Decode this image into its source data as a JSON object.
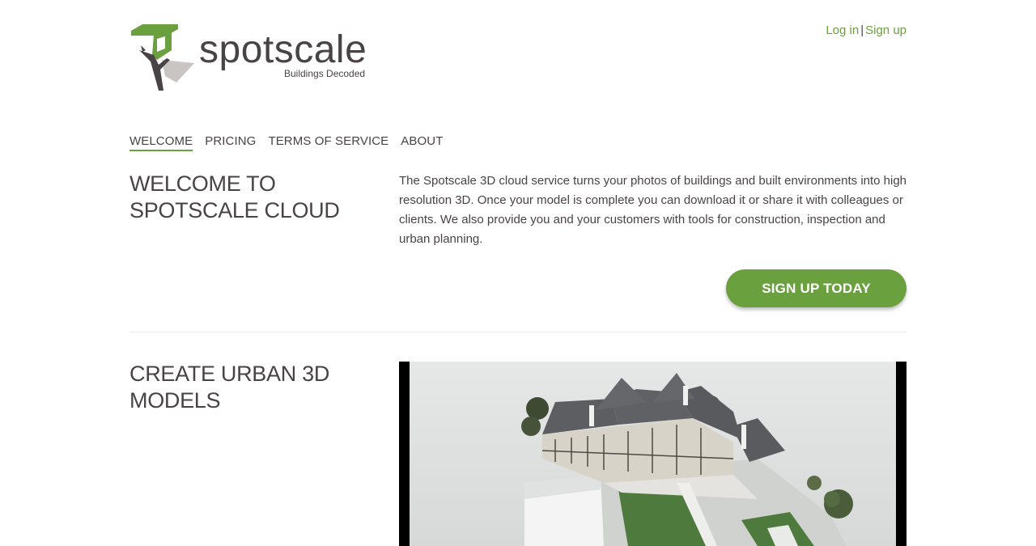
{
  "brand": {
    "name": "spotscale",
    "tagline": "Buildings Decoded",
    "colors": {
      "green": "#6ba03e",
      "text": "#4a4346"
    }
  },
  "auth": {
    "login_label": "Log in",
    "separator": "|",
    "signup_label": "Sign up"
  },
  "nav": {
    "items": [
      {
        "label": "WELCOME",
        "active": true
      },
      {
        "label": "PRICING",
        "active": false
      },
      {
        "label": "TERMS OF SERVICE",
        "active": false
      },
      {
        "label": "ABOUT",
        "active": false
      }
    ]
  },
  "welcome": {
    "heading_line1": "WELCOME TO",
    "heading_line2": "SPOTSCALE CLOUD",
    "body": "The Spotscale 3D cloud service turns your photos of buildings and built environments into high resolution 3D. Once your model is complete you can download it or share it with colleagues or clients. We also provide you and your customers with tools for construction, inspection and urban planning.",
    "cta_label": "SIGN UP TODAY"
  },
  "create": {
    "heading_line1": "CREATE URBAN 3D",
    "heading_line2": "MODELS",
    "media_icon": "3d-building-model-preview"
  }
}
